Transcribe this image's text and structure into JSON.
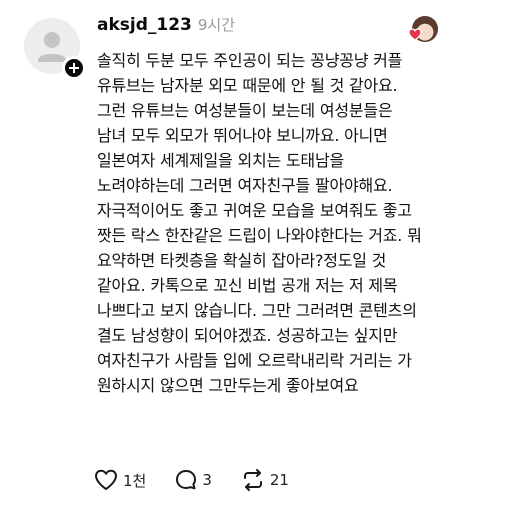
{
  "comment": {
    "username": "aksjd_123",
    "timestamp": "9시간",
    "avatar_icon": "default-user-avatar-icon",
    "follow_icon": "plus-icon",
    "liked_by_icon": "heart-icon",
    "body_lines": [
      "솔직히 두분 모두 주인공이 되는 꽁냥꽁냥 커플",
      "유튜브는 남자분 외모 때문에 안 될 것 같아요.",
      "그런 유튜브는 여성분들이 보는데 여성분들은",
      "남녀 모두 외모가 뛰어나야 보니까요. 아니면",
      "일본여자 세계제일을 외치는 도태남을",
      "노려야하는데 그러면 여자친구들 팔아야해요.",
      "자극적이어도 좋고 귀여운 모습을 보여줘도 좋고",
      "짯든 락스 한잔같은 드립이 나와야한다는 거죠. 뭐",
      "요약하면 타켓층을 확실히 잡아라?정도일 것",
      "같아요. 카톡으로 꼬신 비법 공개 저는 저 제목",
      "나쁘다고 보지 않습니다. 그만 그러려면 콘텐츠의",
      "결도 남성향이 되어야겠죠. 성공하고는 싶지만",
      "여자친구가 사람들 입에 오르락내리락 거리는 가",
      "원하시지 않으면 그만두는게 좋아보여요"
    ],
    "actions": {
      "like_count": "1천",
      "reply_count": "3",
      "repost_count": "21"
    },
    "colors": {
      "text": "#111111",
      "muted": "#9a9a9a",
      "heart": "#e8334a"
    }
  }
}
